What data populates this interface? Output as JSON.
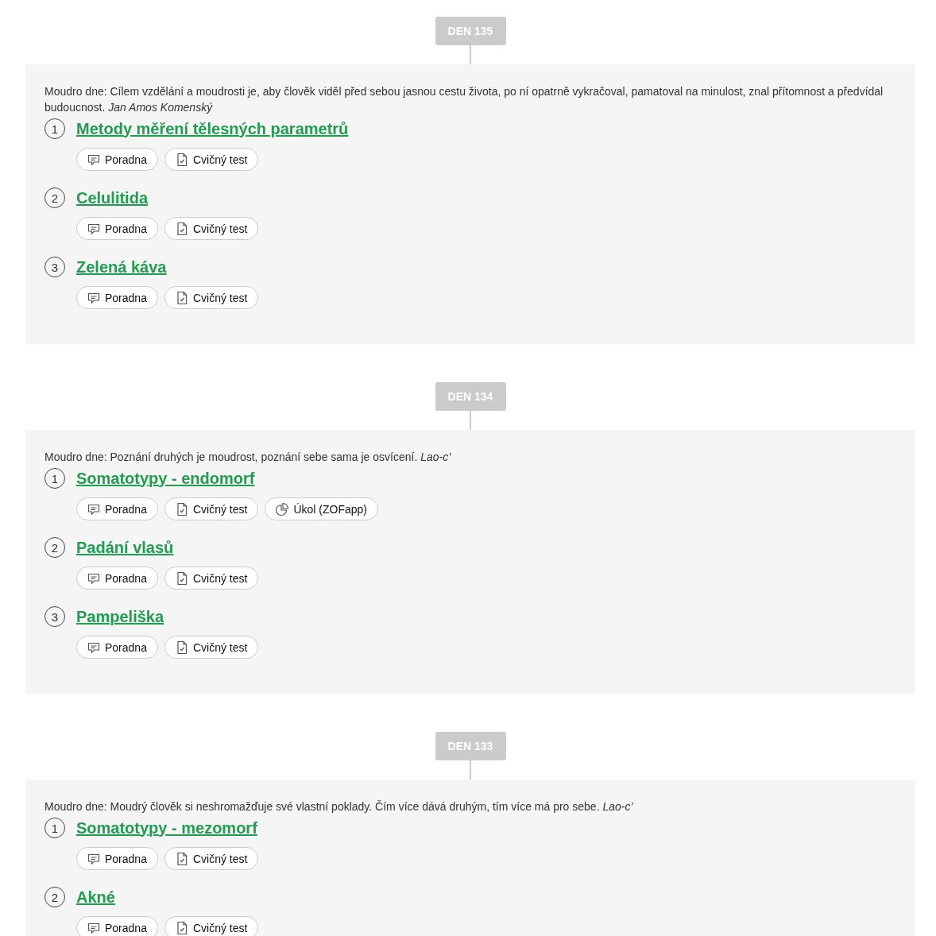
{
  "days": [
    {
      "label": "DEN 135",
      "quote": "Moudro dne: Cílem vzdělání a moudrosti je, aby člověk viděl před sebou jasnou cestu života, po ní opatrně vykračoval, pamatoval na minulost, znal přítomnost a předvídal budoucnost. *Jan Amos Komenský*",
      "topics": [
        {
          "number": "1",
          "title": "Metody měření tělesných parametrů",
          "actions": [
            {
              "kind": "chat",
              "label": "Poradna"
            },
            {
              "kind": "test",
              "label": "Cvičný test"
            }
          ]
        },
        {
          "number": "2",
          "title": "Celulitida",
          "actions": [
            {
              "kind": "chat",
              "label": "Poradna"
            },
            {
              "kind": "test",
              "label": "Cvičný test"
            }
          ]
        },
        {
          "number": "3",
          "title": "Zelená káva",
          "actions": [
            {
              "kind": "chat",
              "label": "Poradna"
            },
            {
              "kind": "test",
              "label": "Cvičný test"
            }
          ]
        }
      ]
    },
    {
      "label": "DEN 134",
      "quote": "Moudro dne: Poznání druhých je moudrost, poznání sebe sama je osvícení. *Lao-c’*",
      "topics": [
        {
          "number": "1",
          "title": "Somatotypy - endomorf",
          "actions": [
            {
              "kind": "chat",
              "label": "Poradna"
            },
            {
              "kind": "test",
              "label": "Cvičný test"
            },
            {
              "kind": "task",
              "label": "Úkol (ZOFapp)"
            }
          ]
        },
        {
          "number": "2",
          "title": "Padání vlasů",
          "actions": [
            {
              "kind": "chat",
              "label": "Poradna"
            },
            {
              "kind": "test",
              "label": "Cvičný test"
            }
          ]
        },
        {
          "number": "3",
          "title": "Pampeliška",
          "actions": [
            {
              "kind": "chat",
              "label": "Poradna"
            },
            {
              "kind": "test",
              "label": "Cvičný test"
            }
          ]
        }
      ]
    },
    {
      "label": "DEN 133",
      "quote": "Moudro dne: Moudrý člověk si neshromažďuje své vlastní poklady. Čím více dává druhým, tím více má pro sebe. *Lao-c’*",
      "topics": [
        {
          "number": "1",
          "title": "Somatotypy - mezomorf",
          "actions": [
            {
              "kind": "chat",
              "label": "Poradna"
            },
            {
              "kind": "test",
              "label": "Cvičný test"
            }
          ]
        },
        {
          "number": "2",
          "title": "Akné",
          "actions": [
            {
              "kind": "chat",
              "label": "Poradna"
            },
            {
              "kind": "test",
              "label": "Cvičný test"
            }
          ]
        }
      ]
    }
  ]
}
